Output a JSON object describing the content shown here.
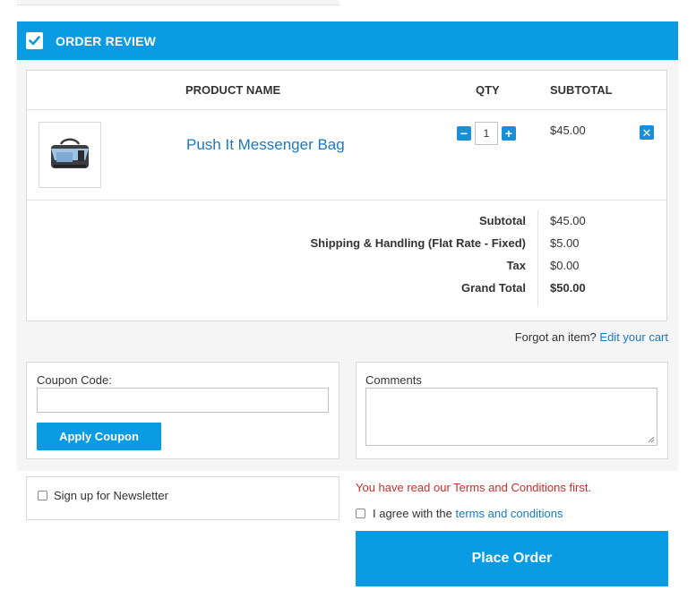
{
  "section": {
    "title": "ORDER REVIEW"
  },
  "table": {
    "headers": {
      "product": "PRODUCT NAME",
      "qty": "QTY",
      "subtotal": "SUBTOTAL"
    },
    "items": [
      {
        "name": "Push It Messenger Bag",
        "qty": "1",
        "subtotal": "$45.00"
      }
    ]
  },
  "totals": {
    "subtotal_label": "Subtotal",
    "subtotal_value": "$45.00",
    "shipping_label": "Shipping & Handling (Flat Rate - Fixed)",
    "shipping_value": "$5.00",
    "tax_label": "Tax",
    "tax_value": "$0.00",
    "grand_label": "Grand Total",
    "grand_value": "$50.00"
  },
  "forgot": {
    "text": "Forgot an item?",
    "link": "Edit your cart"
  },
  "coupon": {
    "label": "Coupon Code:",
    "value": "",
    "button": "Apply Coupon"
  },
  "comments": {
    "label": "Comments",
    "value": ""
  },
  "newsletter": {
    "label": "Sign up for Newsletter"
  },
  "terms": {
    "warning": "You have read our Terms and Conditions first.",
    "agree_text": "I agree with the",
    "agree_link": "terms and conditions"
  },
  "place_order": {
    "label": "Place Order"
  },
  "colors": {
    "accent": "#0a9be3",
    "link": "#1979c3",
    "warning": "#c9302c"
  }
}
